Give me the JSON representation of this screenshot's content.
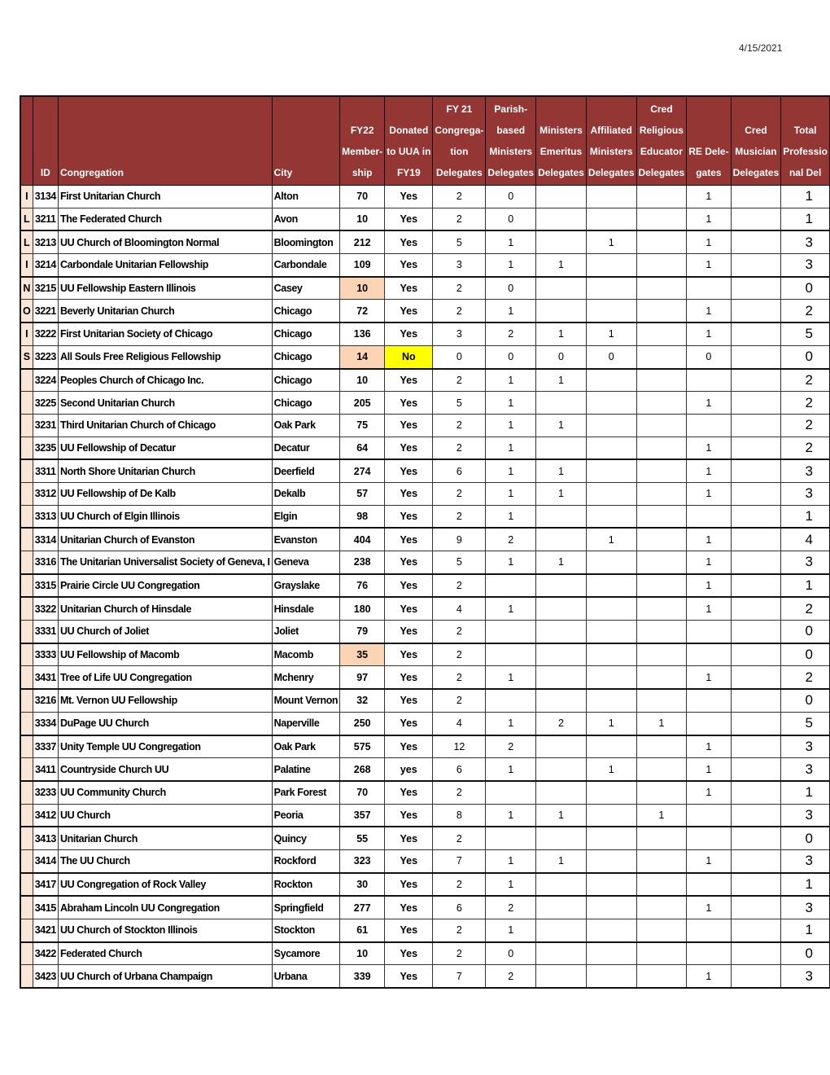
{
  "page": {
    "date": "4/15/2021"
  },
  "colors": {
    "header_bg": "#943634",
    "state_bg": "#fbe5d6",
    "highlight_peach": "#fbd3b5",
    "highlight_yellow": "#ffff00"
  },
  "headers": {
    "state": "",
    "id": "ID",
    "congregation": "Congregation",
    "city": "City",
    "membership": [
      "FY22",
      "Member-",
      "ship"
    ],
    "donated": [
      "Donated",
      "to UUA in",
      "FY19"
    ],
    "fy21": [
      "FY 21",
      "Congrega-",
      "tion",
      "Delegates"
    ],
    "parish": [
      "Parish-",
      "based",
      "Ministers",
      "Delegates"
    ],
    "emeritus": [
      "Ministers",
      "Emeritus",
      "Delegates"
    ],
    "affiliated": [
      "Affiliated",
      "Ministers",
      "Delegates"
    ],
    "cred_re": [
      "Cred",
      "Religious",
      "Educator",
      "Delegates"
    ],
    "re": [
      "RE Dele-",
      "gates"
    ],
    "musician": [
      "Cred",
      "Musician",
      "Delegates"
    ],
    "total": [
      "Total",
      "Professio",
      "nal Del"
    ]
  },
  "rows": [
    {
      "state": "I",
      "id": "3134",
      "congregation": "First Unitarian Church",
      "city": "Alton",
      "membership": "70",
      "donated": "Yes",
      "fy21": "2",
      "parish": "0",
      "emeritus": "",
      "affiliated": "",
      "cred_re": "",
      "re": "1",
      "musician": "",
      "total": "1"
    },
    {
      "state": "L",
      "id": "3211",
      "congregation": "The Federated Church",
      "city": "Avon",
      "membership": "10",
      "donated": "Yes",
      "fy21": "2",
      "parish": "0",
      "emeritus": "",
      "affiliated": "",
      "cred_re": "",
      "re": "1",
      "musician": "",
      "total": "1"
    },
    {
      "state": "L",
      "id": "3213",
      "congregation": "UU Church of Bloomington Normal",
      "city": "Bloomington",
      "membership": "212",
      "donated": "Yes",
      "fy21": "5",
      "parish": "1",
      "emeritus": "",
      "affiliated": "1",
      "cred_re": "",
      "re": "1",
      "musician": "",
      "total": "3"
    },
    {
      "state": "I",
      "id": "3214",
      "congregation": "Carbondale Unitarian Fellowship",
      "city": "Carbondale",
      "membership": "109",
      "donated": "Yes",
      "fy21": "3",
      "parish": "1",
      "emeritus": "1",
      "affiliated": "",
      "cred_re": "",
      "re": "1",
      "musician": "",
      "total": "3"
    },
    {
      "state": "N",
      "id": "3215",
      "congregation": "UU Fellowship Eastern Illinois",
      "city": "Casey",
      "membership": "10",
      "membership_highlight": "peach",
      "donated": "Yes",
      "fy21": "2",
      "parish": "0",
      "emeritus": "",
      "affiliated": "",
      "cred_re": "",
      "re": "",
      "musician": "",
      "total": "0"
    },
    {
      "state": "O",
      "id": "3221",
      "congregation": "Beverly Unitarian Church",
      "city": "Chicago",
      "membership": "72",
      "donated": "Yes",
      "fy21": "2",
      "parish": "1",
      "emeritus": "",
      "affiliated": "",
      "cred_re": "",
      "re": "1",
      "musician": "",
      "total": "2"
    },
    {
      "state": "I",
      "id": "3222",
      "congregation": "First Unitarian Society of Chicago",
      "city": "Chicago",
      "membership": "136",
      "donated": "Yes",
      "fy21": "3",
      "parish": "2",
      "emeritus": "1",
      "affiliated": "1",
      "cred_re": "",
      "re": "1",
      "musician": "",
      "total": "5"
    },
    {
      "state": "S",
      "id": "3223",
      "congregation": "All Souls Free Religious Fellowship",
      "city": "Chicago",
      "membership": "14",
      "membership_highlight": "peach",
      "donated": "No",
      "donated_highlight": "yellow",
      "fy21": "0",
      "parish": "0",
      "emeritus": "0",
      "affiliated": "0",
      "cred_re": "",
      "re": "0",
      "musician": "",
      "total": "0"
    },
    {
      "state": "",
      "id": "3224",
      "congregation": "Peoples Church of Chicago Inc.",
      "city": "Chicago",
      "membership": "10",
      "donated": "Yes",
      "fy21": "2",
      "parish": "1",
      "emeritus": "1",
      "affiliated": "",
      "cred_re": "",
      "re": "",
      "musician": "",
      "total": "2"
    },
    {
      "state": "",
      "id": "3225",
      "congregation": "Second Unitarian Church",
      "city": "Chicago",
      "membership": "205",
      "donated": "Yes",
      "fy21": "5",
      "parish": "1",
      "emeritus": "",
      "affiliated": "",
      "cred_re": "",
      "re": "1",
      "musician": "",
      "total": "2"
    },
    {
      "state": "",
      "id": "3231",
      "congregation": "Third Unitarian Church of Chicago",
      "city": "Oak Park",
      "membership": "75",
      "donated": "Yes",
      "fy21": "2",
      "parish": "1",
      "emeritus": "1",
      "affiliated": "",
      "cred_re": "",
      "re": "",
      "musician": "",
      "total": "2"
    },
    {
      "state": "",
      "id": "3235",
      "congregation": "UU Fellowship of Decatur",
      "city": "Decatur",
      "membership": "64",
      "donated": "Yes",
      "fy21": "2",
      "parish": "1",
      "emeritus": "",
      "affiliated": "",
      "cred_re": "",
      "re": "1",
      "musician": "",
      "total": "2"
    },
    {
      "state": "",
      "id": "3311",
      "congregation": "North Shore Unitarian Church",
      "city": "Deerfield",
      "membership": "274",
      "donated": "Yes",
      "fy21": "6",
      "parish": "1",
      "emeritus": "1",
      "affiliated": "",
      "cred_re": "",
      "re": "1",
      "musician": "",
      "total": "3"
    },
    {
      "state": "",
      "id": "3312",
      "congregation": "UU Fellowship of De Kalb",
      "city": "Dekalb",
      "membership": "57",
      "donated": "Yes",
      "fy21": "2",
      "parish": "1",
      "emeritus": "1",
      "affiliated": "",
      "cred_re": "",
      "re": "1",
      "musician": "",
      "total": "3"
    },
    {
      "state": "",
      "id": "3313",
      "congregation": "UU Church of Elgin Illinois",
      "city": "Elgin",
      "membership": "98",
      "donated": "Yes",
      "fy21": "2",
      "parish": "1",
      "emeritus": "",
      "affiliated": "",
      "cred_re": "",
      "re": "",
      "musician": "",
      "total": "1"
    },
    {
      "state": "",
      "id": "3314",
      "congregation": "Unitarian Church of Evanston",
      "city": "Evanston",
      "membership": "404",
      "donated": "Yes",
      "fy21": "9",
      "parish": "2",
      "emeritus": "",
      "affiliated": "1",
      "cred_re": "",
      "re": "1",
      "musician": "",
      "total": "4"
    },
    {
      "state": "",
      "id": "3316",
      "congregation": "The Unitarian Universalist Society of Geneva, I",
      "city": "Geneva",
      "membership": "238",
      "donated": "Yes",
      "fy21": "5",
      "parish": "1",
      "emeritus": "1",
      "affiliated": "",
      "cred_re": "",
      "re": "1",
      "musician": "",
      "total": "3"
    },
    {
      "state": "",
      "id": "3315",
      "congregation": "Prairie Circle UU Congregation",
      "city": "Grayslake",
      "membership": "76",
      "donated": "Yes",
      "fy21": "2",
      "parish": "",
      "emeritus": "",
      "affiliated": "",
      "cred_re": "",
      "re": "1",
      "musician": "",
      "total": "1"
    },
    {
      "state": "",
      "id": "3322",
      "congregation": "Unitarian Church of Hinsdale",
      "city": "Hinsdale",
      "membership": "180",
      "donated": "Yes",
      "fy21": "4",
      "parish": "1",
      "emeritus": "",
      "affiliated": "",
      "cred_re": "",
      "re": "1",
      "musician": "",
      "total": "2"
    },
    {
      "state": "",
      "id": "3331",
      "congregation": "UU Church of Joliet",
      "city": "Joliet",
      "membership": "79",
      "donated": "Yes",
      "fy21": "2",
      "parish": "",
      "emeritus": "",
      "affiliated": "",
      "cred_re": "",
      "re": "",
      "musician": "",
      "total": "0"
    },
    {
      "state": "",
      "id": "3333",
      "congregation": "UU Fellowship of Macomb",
      "city": "Macomb",
      "membership": "35",
      "membership_highlight": "peach",
      "donated": "Yes",
      "fy21": "2",
      "parish": "",
      "emeritus": "",
      "affiliated": "",
      "cred_re": "",
      "re": "",
      "musician": "",
      "total": "0"
    },
    {
      "state": "",
      "id": "3431",
      "congregation": "Tree of Life UU Congregation",
      "city": "Mchenry",
      "membership": "97",
      "donated": "Yes",
      "fy21": "2",
      "parish": "1",
      "emeritus": "",
      "affiliated": "",
      "cred_re": "",
      "re": "1",
      "musician": "",
      "total": "2"
    },
    {
      "state": "",
      "id": "3216",
      "congregation": "Mt. Vernon UU Fellowship",
      "city": "Mount Vernon",
      "membership": "32",
      "donated": "Yes",
      "fy21": "2",
      "parish": "",
      "emeritus": "",
      "affiliated": "",
      "cred_re": "",
      "re": "",
      "musician": "",
      "total": "0"
    },
    {
      "state": "",
      "id": "3334",
      "congregation": "DuPage UU Church",
      "city": "Naperville",
      "membership": "250",
      "donated": "Yes",
      "fy21": "4",
      "parish": "1",
      "emeritus": "2",
      "affiliated": "1",
      "cred_re": "1",
      "re": "",
      "musician": "",
      "total": "5"
    },
    {
      "state": "",
      "id": "3337",
      "congregation": "Unity Temple UU Congregation",
      "city": "Oak Park",
      "membership": "575",
      "donated": "Yes",
      "fy21": "12",
      "parish": "2",
      "emeritus": "",
      "affiliated": "",
      "cred_re": "",
      "re": "1",
      "musician": "",
      "total": "3"
    },
    {
      "state": "",
      "id": "3411",
      "congregation": "Countryside Church   UU",
      "city": "Palatine",
      "membership": "268",
      "donated": "yes",
      "fy21": "6",
      "parish": "1",
      "emeritus": "",
      "affiliated": "1",
      "cred_re": "",
      "re": "1",
      "musician": "",
      "total": "3"
    },
    {
      "state": "",
      "id": "3233",
      "congregation": "UU Community Church",
      "city": "Park Forest",
      "membership": "70",
      "donated": "Yes",
      "fy21": "2",
      "parish": "",
      "emeritus": "",
      "affiliated": "",
      "cred_re": "",
      "re": "1",
      "musician": "",
      "total": "1"
    },
    {
      "state": "",
      "id": "3412",
      "congregation": "UU Church",
      "city": "Peoria",
      "membership": "357",
      "donated": "Yes",
      "fy21": "8",
      "parish": "1",
      "emeritus": "1",
      "affiliated": "",
      "cred_re": "1",
      "re": "",
      "musician": "",
      "total": "3"
    },
    {
      "state": "",
      "id": "3413",
      "congregation": "Unitarian Church",
      "city": "Quincy",
      "membership": "55",
      "donated": "Yes",
      "fy21": "2",
      "parish": "",
      "emeritus": "",
      "affiliated": "",
      "cred_re": "",
      "re": "",
      "musician": "",
      "total": "0"
    },
    {
      "state": "",
      "id": "3414",
      "congregation": "The UU Church",
      "city": "Rockford",
      "membership": "323",
      "donated": "Yes",
      "fy21": "7",
      "parish": "1",
      "emeritus": "1",
      "affiliated": "",
      "cred_re": "",
      "re": "1",
      "musician": "",
      "total": "3"
    },
    {
      "state": "",
      "id": "3417",
      "congregation": "UU Congregation of Rock Valley",
      "city": "Rockton",
      "membership": "30",
      "donated": "Yes",
      "fy21": "2",
      "parish": "1",
      "emeritus": "",
      "affiliated": "",
      "cred_re": "",
      "re": "",
      "musician": "",
      "total": "1"
    },
    {
      "state": "",
      "id": "3415",
      "congregation": "Abraham Lincoln UU Congregation",
      "city": "Springfield",
      "membership": "277",
      "donated": "Yes",
      "fy21": "6",
      "parish": "2",
      "emeritus": "",
      "affiliated": "",
      "cred_re": "",
      "re": "1",
      "musician": "",
      "total": "3"
    },
    {
      "state": "",
      "id": "3421",
      "congregation": "UU Church of Stockton Illinois",
      "city": "Stockton",
      "membership": "61",
      "donated": "Yes",
      "fy21": "2",
      "parish": "1",
      "emeritus": "",
      "affiliated": "",
      "cred_re": "",
      "re": "",
      "musician": "",
      "total": "1"
    },
    {
      "state": "",
      "id": "3422",
      "congregation": "Federated Church",
      "city": "Sycamore",
      "membership": "10",
      "donated": "Yes",
      "fy21": "2",
      "parish": "0",
      "emeritus": "",
      "affiliated": "",
      "cred_re": "",
      "re": "",
      "musician": "",
      "total": "0"
    },
    {
      "state": "",
      "id": "3423",
      "congregation": "UU Church of Urbana Champaign",
      "city": "Urbana",
      "membership": "339",
      "donated": "Yes",
      "fy21": "7",
      "parish": "2",
      "emeritus": "",
      "affiliated": "",
      "cred_re": "",
      "re": "1",
      "musician": "",
      "total": "3"
    }
  ]
}
